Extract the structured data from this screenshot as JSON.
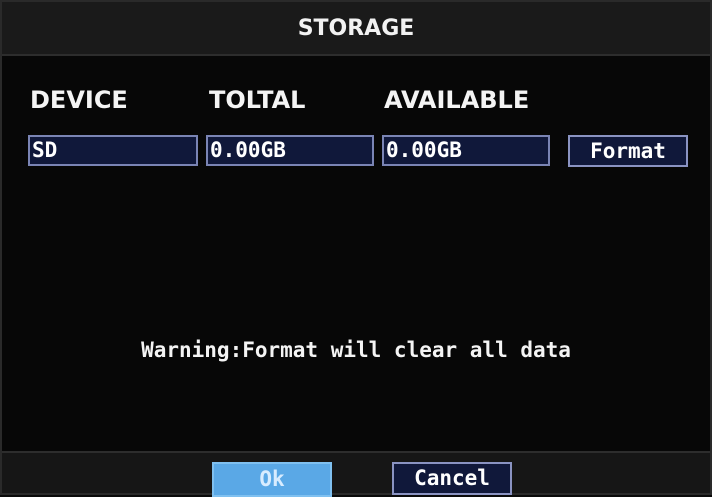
{
  "dialog": {
    "title": "STORAGE"
  },
  "columns": {
    "device": "DEVICE",
    "total": "TOLTAL",
    "available": "AVAILABLE"
  },
  "storage_row": {
    "device": "SD",
    "total": "0.00GB",
    "available": "0.00GB"
  },
  "buttons": {
    "format": "Format",
    "ok": "Ok",
    "cancel": "Cancel"
  },
  "warning": "Warning:Format will clear all data",
  "colors": {
    "background": "#070707",
    "field_fill": "#10183a",
    "field_border": "#7a84b4",
    "ok_highlight": "#5aa8e6",
    "text": "#ffffff"
  }
}
